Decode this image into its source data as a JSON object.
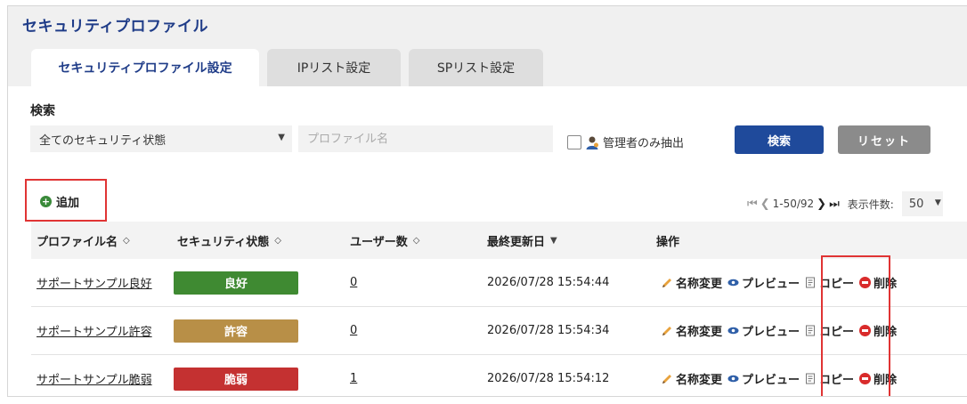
{
  "page_title": "セキュリティプロファイル",
  "tabs": [
    {
      "label": "セキュリティプロファイル設定",
      "active": true
    },
    {
      "label": "IPリスト設定",
      "active": false
    },
    {
      "label": "SPリスト設定",
      "active": false
    }
  ],
  "search": {
    "label": "検索",
    "status_select_value": "全てのセキュリティ状態",
    "name_placeholder": "プロファイル名",
    "admin_only_label": "管理者のみ抽出",
    "search_button": "検索",
    "reset_button": "リセット"
  },
  "toolbar": {
    "add_label": "追加",
    "pager_range": "1-50/92",
    "per_page_label": "表示件数:",
    "per_page_value": "50"
  },
  "table": {
    "headers": {
      "name": "プロファイル名",
      "status": "セキュリティ状態",
      "users": "ユーザー数",
      "updated": "最終更新日",
      "actions": "操作"
    },
    "actions": {
      "rename": "名称変更",
      "preview": "プレビュー",
      "copy": "コピー",
      "delete": "削除"
    },
    "rows": [
      {
        "name": "サポートサンプル良好",
        "status": "良好",
        "status_color": "#3f8a32",
        "users": "0",
        "updated": "2026/07/28 15:54:44"
      },
      {
        "name": "サポートサンプル許容",
        "status": "許容",
        "status_color": "#b88f47",
        "users": "0",
        "updated": "2026/07/28 15:54:34"
      },
      {
        "name": "サポートサンプル脆弱",
        "status": "脆弱",
        "status_color": "#c43131",
        "users": "1",
        "updated": "2026/07/28 15:54:12"
      }
    ]
  },
  "colors": {
    "accent": "#1f4a9b",
    "highlight": "#e03434"
  }
}
